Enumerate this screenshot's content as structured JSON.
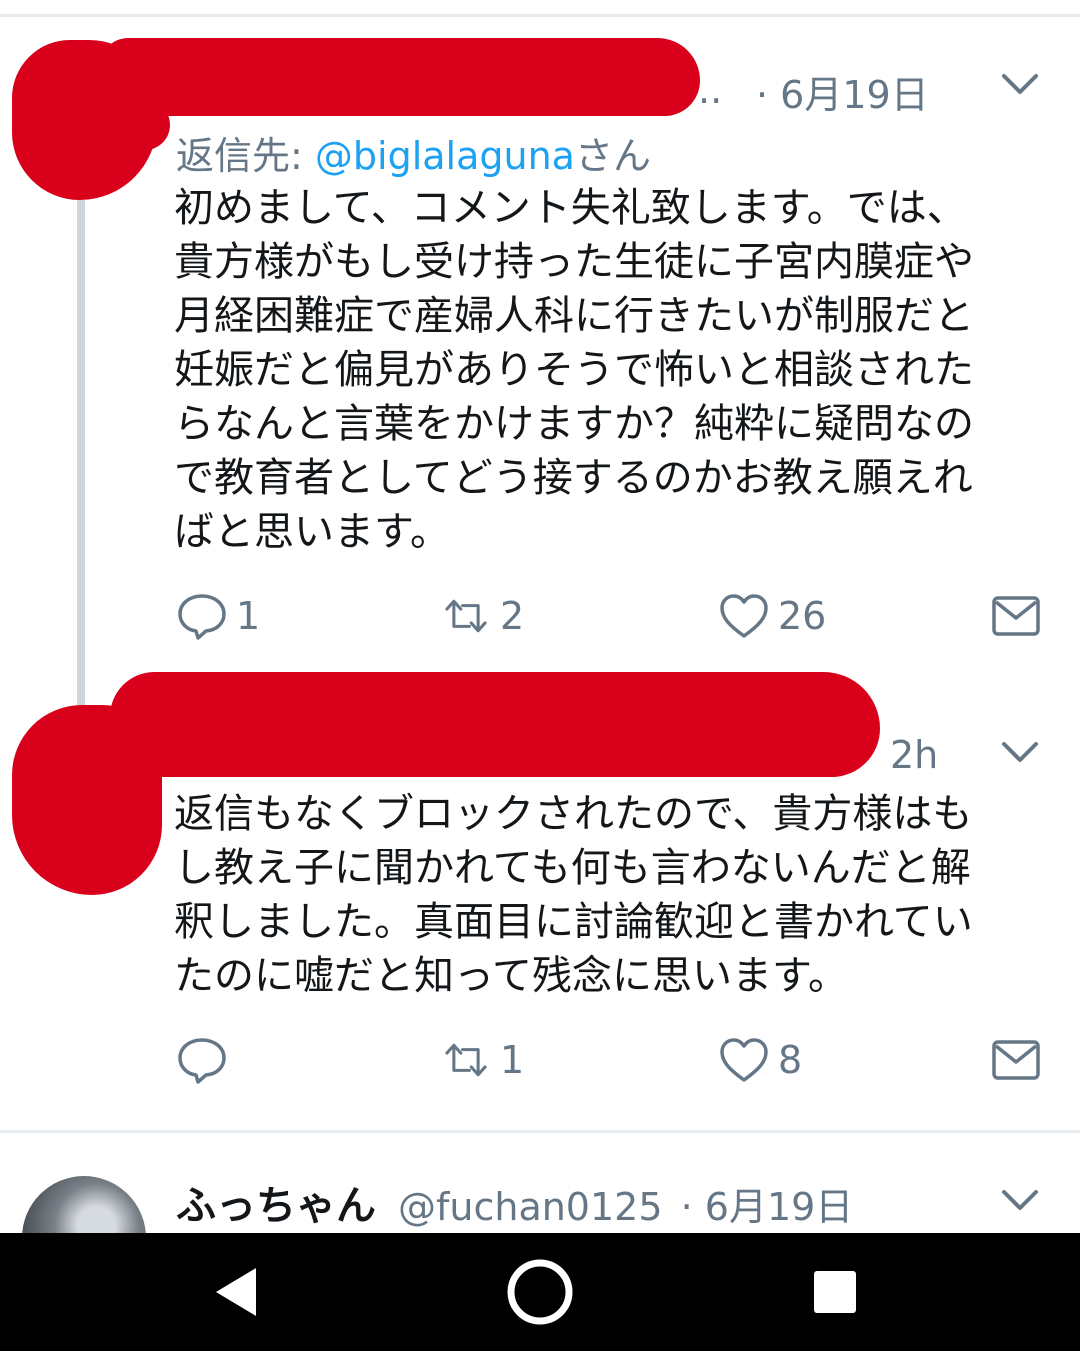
{
  "tweets": [
    {
      "time": "· 6月19日",
      "truncated_suffix": "..",
      "reply_prefix": "返信先: ",
      "reply_handle": "@biglalaguna",
      "reply_suffix": "さん",
      "text": "初めまして、コメント失礼致します。では、\n貴方様がもし受け持った生徒に子宮内膜症や\n月経困難症で産婦人科に行きたいが制服だと\n妊娠だと偏見がありそうで怖いと相談された\nらなんと言葉をかけますか？純粋に疑問なの\nで教育者としてどう接するのかお教え願えれ\nばと思います。",
      "reply_count": "1",
      "retweet_count": "2",
      "like_count": "26"
    },
    {
      "time": "2h",
      "text": "返信もなくブロックされたので、貴方様はも\nし教え子に聞かれても何も言わないんだと解\n釈しました。真面目に討論歓迎と書かれてい\nたのに嘘だと知って残念に思います。",
      "reply_count": "",
      "retweet_count": "1",
      "like_count": "8"
    }
  ],
  "next_tweet": {
    "name": "ふっちゃん",
    "handle": "@fuchan0125",
    "time": "· 6月19日"
  },
  "icons": {
    "reply": "reply-icon",
    "retweet": "retweet-icon",
    "like": "heart-icon",
    "dm": "mail-icon",
    "menu": "chevron-down-icon",
    "back": "nav-back-icon",
    "home": "nav-home-icon",
    "recents": "nav-recents-icon"
  },
  "colors": {
    "link": "#1da1f2",
    "muted": "#657786",
    "redaction": "#d9001b"
  }
}
